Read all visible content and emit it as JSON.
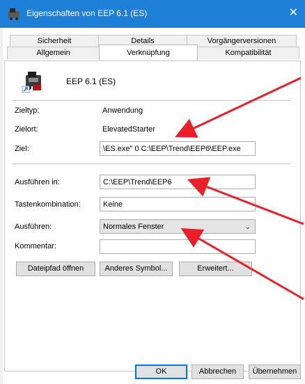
{
  "window": {
    "title": "Eigenschaften von EEP 6.1 (ES)",
    "close_glyph": "✕"
  },
  "tabs": {
    "row1": [
      "Sicherheit",
      "Details",
      "Vorgängerversionen"
    ],
    "row2": [
      "Allgemein",
      "Verknüpfung",
      "Kompatibilität"
    ],
    "active": "Verknüpfung"
  },
  "shortcut": {
    "name": "EEP 6.1 (ES)",
    "icon": "eep-app-icon",
    "zieltyp_label": "Zieltyp:",
    "zieltyp_value": "Anwendung",
    "zielort_label": "Zielort:",
    "zielort_value": "ElevatedStarter",
    "ziel_label": "Ziel:",
    "ziel_value": "\\ES.exe\" 0 C:\\EEP\\Trend\\EEP6\\EEP.exe",
    "ausfuehren_in_label": "Ausführen in:",
    "ausfuehren_in_value": "C:\\EEP\\Trend\\EEP6",
    "tastenkombination_label": "Tastenkombination:",
    "tastenkombination_value": "Keine",
    "ausfuehren_label": "Ausführen:",
    "ausfuehren_value": "Normales Fenster",
    "kommentar_label": "Kommentar:",
    "kommentar_value": ""
  },
  "action_buttons": {
    "open_path": "Dateipfad öffnen",
    "change_icon": "Anderes Symbol...",
    "advanced": "Erweitert..."
  },
  "footer": {
    "ok": "OK",
    "cancel": "Abbrechen",
    "apply": "Übernehmen"
  },
  "colors": {
    "titlebar": "#1e7fd6",
    "annotation_arrow": "#e8202a"
  }
}
